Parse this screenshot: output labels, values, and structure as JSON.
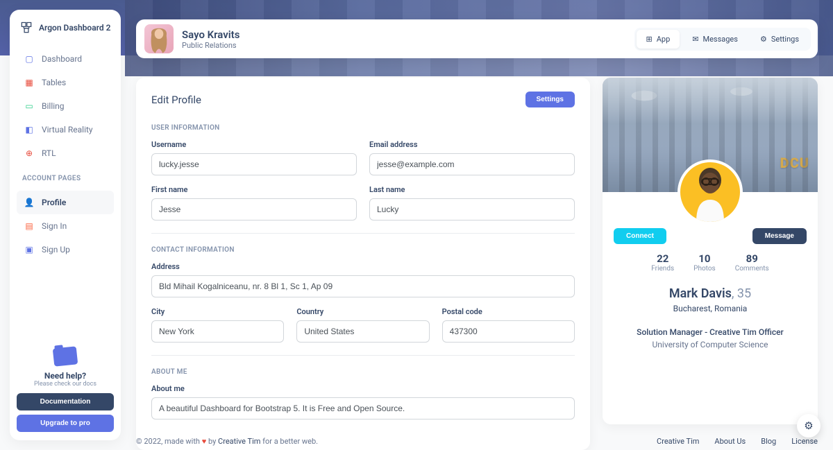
{
  "brand": "Argon Dashboard 2",
  "nav": {
    "items": [
      {
        "label": "Dashboard",
        "icon": "▢"
      },
      {
        "label": "Tables",
        "icon": "▦"
      },
      {
        "label": "Billing",
        "icon": "💳"
      },
      {
        "label": "Virtual Reality",
        "icon": "🧊"
      },
      {
        "label": "RTL",
        "icon": "🌐"
      }
    ],
    "section_label": "ACCOUNT PAGES",
    "account_items": [
      {
        "label": "Profile",
        "icon": "👤",
        "active": true
      },
      {
        "label": "Sign In",
        "icon": "📄"
      },
      {
        "label": "Sign Up",
        "icon": "🚀"
      }
    ]
  },
  "help": {
    "title": "Need help?",
    "subtitle": "Please check our docs",
    "doc_btn": "Documentation",
    "upgrade_btn": "Upgrade to pro"
  },
  "header": {
    "name": "Sayo Kravits",
    "role": "Public Relations",
    "tabs": [
      {
        "label": "App",
        "icon": "⊞",
        "active": true
      },
      {
        "label": "Messages",
        "icon": "✉"
      },
      {
        "label": "Settings",
        "icon": "⚙"
      }
    ]
  },
  "edit": {
    "title": "Edit Profile",
    "settings_btn": "Settings",
    "sections": {
      "user": "USER INFORMATION",
      "contact": "CONTACT INFORMATION",
      "about": "ABOUT ME"
    },
    "labels": {
      "username": "Username",
      "email": "Email address",
      "firstname": "First name",
      "lastname": "Last name",
      "address": "Address",
      "city": "City",
      "country": "Country",
      "postal": "Postal code",
      "aboutme": "About me"
    },
    "values": {
      "username": "lucky.jesse",
      "email": "jesse@example.com",
      "firstname": "Jesse",
      "lastname": "Lucky",
      "address": "Bld Mihail Kogalniceanu, nr. 8 Bl 1, Sc 1, Ap 09",
      "city": "New York",
      "country": "United States",
      "postal": "437300",
      "aboutme": "A beautiful Dashboard for Bootstrap 5. It is Free and Open Source."
    }
  },
  "profile": {
    "cover_logo": "DCU",
    "connect_btn": "Connect",
    "message_btn": "Message",
    "stats": [
      {
        "val": "22",
        "lbl": "Friends"
      },
      {
        "val": "10",
        "lbl": "Photos"
      },
      {
        "val": "89",
        "lbl": "Comments"
      }
    ],
    "name": "Mark Davis",
    "age": ", 35",
    "location": "Bucharest, Romania",
    "job": "Solution Manager - Creative Tim Officer",
    "school": "University of Computer Science"
  },
  "footer": {
    "copyright_prefix": "© 2022, made with ",
    "copyright_mid": " by ",
    "brand": "Creative Tim",
    "copyright_suffix": " for a better web.",
    "links": [
      "Creative Tim",
      "About Us",
      "Blog",
      "License"
    ]
  }
}
